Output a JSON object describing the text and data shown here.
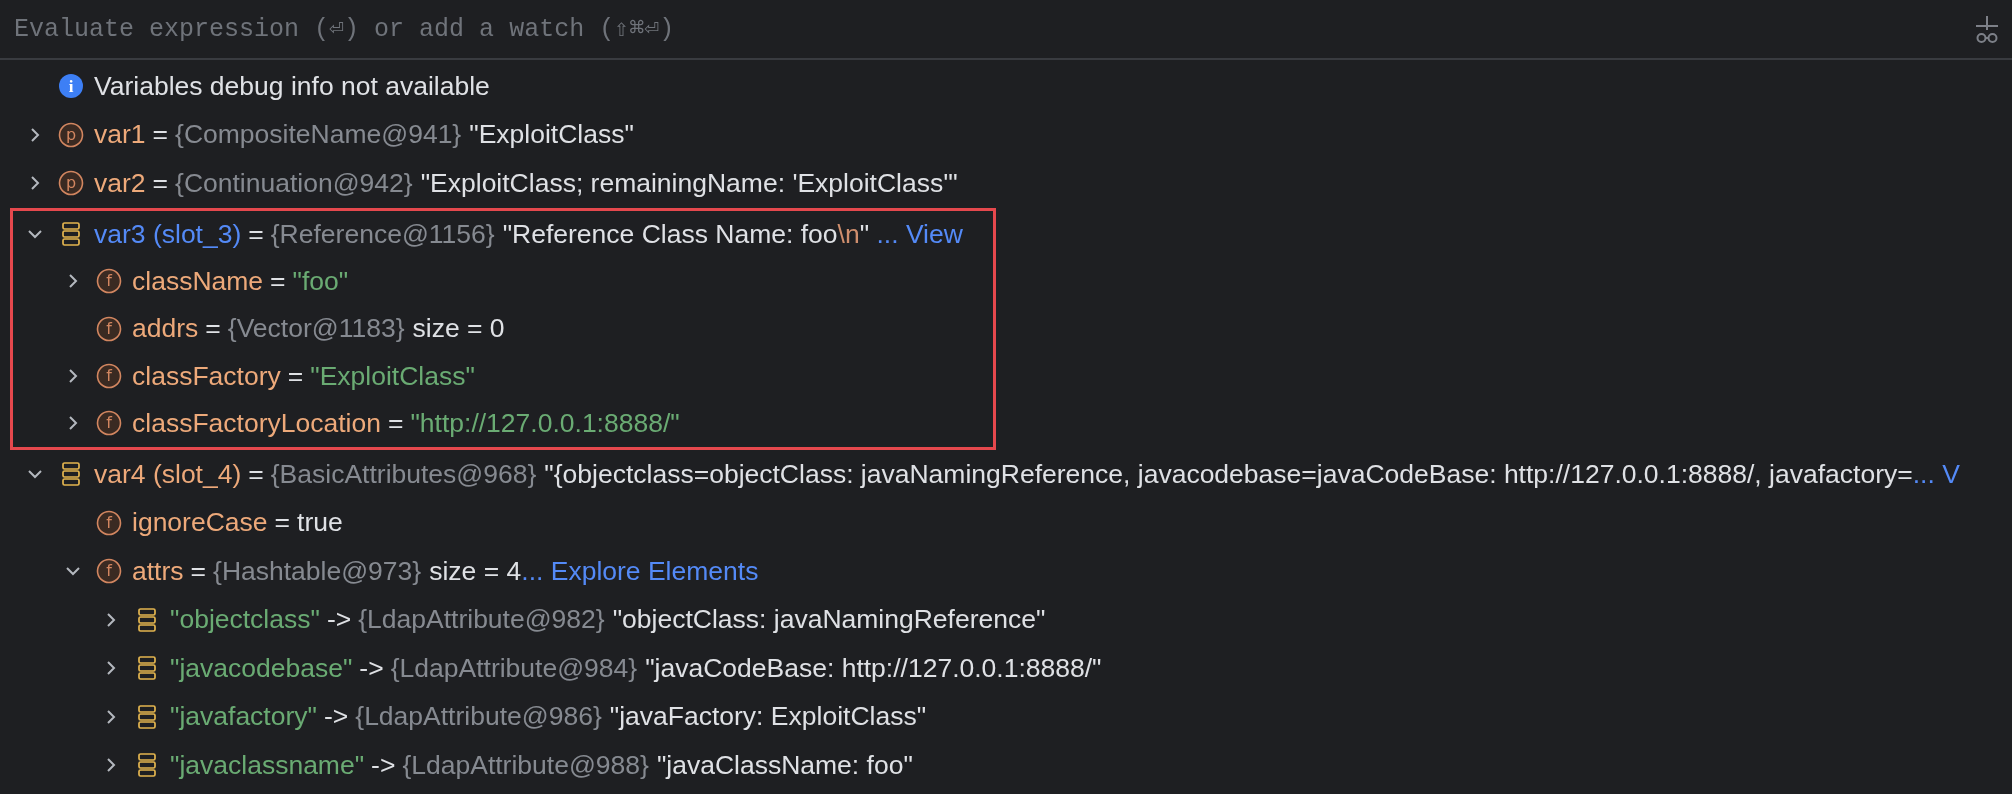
{
  "watch_bar": {
    "placeholder": "Evaluate expression (⏎) or add a watch (⇧⌘⏎)"
  },
  "variables": {
    "nodes": [
      {
        "kind": "info",
        "icon_letter": "i",
        "text": "Variables debug info not available"
      },
      {
        "kind": "param",
        "icon_letter": "p",
        "expanded": false,
        "name": "var1",
        "operator": "=",
        "type": "{CompositeName@941}",
        "value": [
          {
            "text": "\"ExploitClass\"",
            "kind": "plain"
          }
        ]
      },
      {
        "kind": "param",
        "icon_letter": "p",
        "expanded": false,
        "name": "var2",
        "operator": "=",
        "type": "{Continuation@942}",
        "value": [
          {
            "text": "\"ExploitClass; remainingName: 'ExploitClass'\"",
            "kind": "plain"
          }
        ]
      },
      {
        "kind": "local",
        "expanded": true,
        "modified": true,
        "highlighted": true,
        "name": "var3 (slot_3)",
        "operator": "=",
        "type": "{Reference@1156}",
        "value": [
          {
            "text": "\"Reference Class Name: foo",
            "kind": "plain"
          },
          {
            "text": "\\n",
            "kind": "escape"
          },
          {
            "text": "\" ",
            "kind": "plain"
          }
        ],
        "link": "... View",
        "children": [
          {
            "kind": "field",
            "icon_letter": "f",
            "expanded": false,
            "name": "className",
            "operator": "=",
            "value": [
              {
                "text": "\"foo\"",
                "kind": "string"
              }
            ]
          },
          {
            "kind": "field",
            "icon_letter": "f",
            "name": "addrs",
            "operator": "=",
            "type": "{Vector@1183}",
            "value": [
              {
                "text": "size = 0",
                "kind": "plain"
              }
            ]
          },
          {
            "kind": "field",
            "icon_letter": "f",
            "expanded": false,
            "name": "classFactory",
            "operator": "=",
            "value": [
              {
                "text": "\"ExploitClass\"",
                "kind": "string"
              }
            ]
          },
          {
            "kind": "field",
            "icon_letter": "f",
            "expanded": false,
            "name": "classFactoryLocation",
            "operator": "=",
            "value": [
              {
                "text": "\"http://127.0.0.1:8888/\"",
                "kind": "string"
              }
            ]
          }
        ]
      },
      {
        "kind": "local",
        "expanded": true,
        "modified": false,
        "highlighted": false,
        "name": "var4 (slot_4)",
        "operator": "=",
        "type": "{BasicAttributes@968}",
        "value": [
          {
            "text": "\"{objectclass=objectClass: javaNamingReference, javacodebase=javaCodeBase: http://127.0.0.1:8888/, javafactory=",
            "kind": "plain"
          }
        ],
        "link": "... V",
        "children": [
          {
            "kind": "field",
            "icon_letter": "f",
            "name": "ignoreCase",
            "operator": "=",
            "value": [
              {
                "text": "true",
                "kind": "plain"
              }
            ]
          },
          {
            "kind": "field",
            "icon_letter": "f",
            "expanded": true,
            "name": "attrs",
            "operator": "=",
            "type": "{Hashtable@973}",
            "value": [
              {
                "text": "size = 4",
                "kind": "plain"
              }
            ],
            "link": "... Explore Elements",
            "children": [
              {
                "kind": "entry",
                "expanded": false,
                "name": "\"objectclass\"",
                "operator": "->",
                "type": "{LdapAttribute@982}",
                "value": [
                  {
                    "text": "\"objectClass: javaNamingReference\"",
                    "kind": "plain"
                  }
                ]
              },
              {
                "kind": "entry",
                "expanded": false,
                "name": "\"javacodebase\"",
                "operator": "->",
                "type": "{LdapAttribute@984}",
                "value": [
                  {
                    "text": "\"javaCodeBase: http://127.0.0.1:8888/\"",
                    "kind": "plain"
                  }
                ]
              },
              {
                "kind": "entry",
                "expanded": false,
                "name": "\"javafactory\"",
                "operator": "->",
                "type": "{LdapAttribute@986}",
                "value": [
                  {
                    "text": "\"javaFactory: ExploitClass\"",
                    "kind": "plain"
                  }
                ]
              },
              {
                "kind": "entry",
                "expanded": false,
                "name": "\"javaclassname\"",
                "operator": "->",
                "type": "{LdapAttribute@988}",
                "value": [
                  {
                    "text": "\"javaClassName: foo\"",
                    "kind": "plain"
                  }
                ]
              }
            ]
          }
        ]
      }
    ]
  }
}
